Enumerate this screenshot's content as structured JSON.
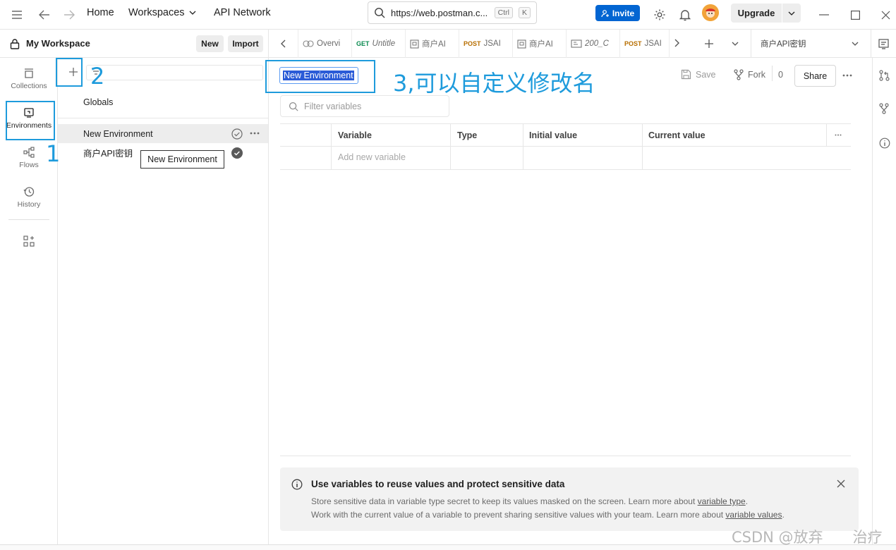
{
  "titlebar": {
    "home": "Home",
    "workspaces": "Workspaces",
    "api_network": "API Network",
    "url": "https://web.postman.c...",
    "kbd_ctrl": "Ctrl",
    "kbd_k": "K",
    "invite": "Invite",
    "upgrade": "Upgrade"
  },
  "workspace": {
    "name": "My Workspace",
    "new_btn": "New",
    "import_btn": "Import"
  },
  "rail": {
    "collections": "Collections",
    "environments": "Environments",
    "flows": "Flows",
    "history": "History"
  },
  "envlist": {
    "globals": "Globals",
    "items": [
      {
        "label": "New Environment"
      },
      {
        "label": "商户API密钥"
      }
    ],
    "tooltip": "New Environment"
  },
  "tabs": [
    {
      "method": "",
      "label": "Overvi"
    },
    {
      "method": "GET",
      "label": "Untitle"
    },
    {
      "method": "",
      "label": "商户AI"
    },
    {
      "method": "POST",
      "label": "JSAI"
    },
    {
      "method": "",
      "label": "商户AI"
    },
    {
      "method": "",
      "label": "200_C"
    },
    {
      "method": "POST",
      "label": "JSAI"
    }
  ],
  "env_selector": "商户API密钥",
  "editor": {
    "env_name": "New Environment",
    "save": "Save",
    "fork": "Fork",
    "fork_count": "0",
    "share": "Share",
    "filter_placeholder": "Filter variables",
    "columns": [
      "Variable",
      "Type",
      "Initial value",
      "Current value"
    ],
    "add_placeholder": "Add new variable"
  },
  "banner": {
    "title": "Use variables to reuse values and protect sensitive data",
    "line1_pre": "Store sensitive data in variable type secret to keep its values masked on the screen. Learn more about ",
    "line1_link": "variable type",
    "line1_post": ".",
    "line2_pre": "Work with the current value of a variable to prevent sharing sensitive values with your team. Learn more about ",
    "line2_link": "variable values",
    "line2_post": "."
  },
  "annotations": {
    "a1": "1",
    "a2": "2",
    "a3": "3,可以自定义修改名"
  },
  "watermark": "CSDN @放弃　　治疗",
  "colors": {
    "accent": "#0265d2",
    "annotation": "#1e9bdc",
    "selection": "#2a5bd7"
  }
}
